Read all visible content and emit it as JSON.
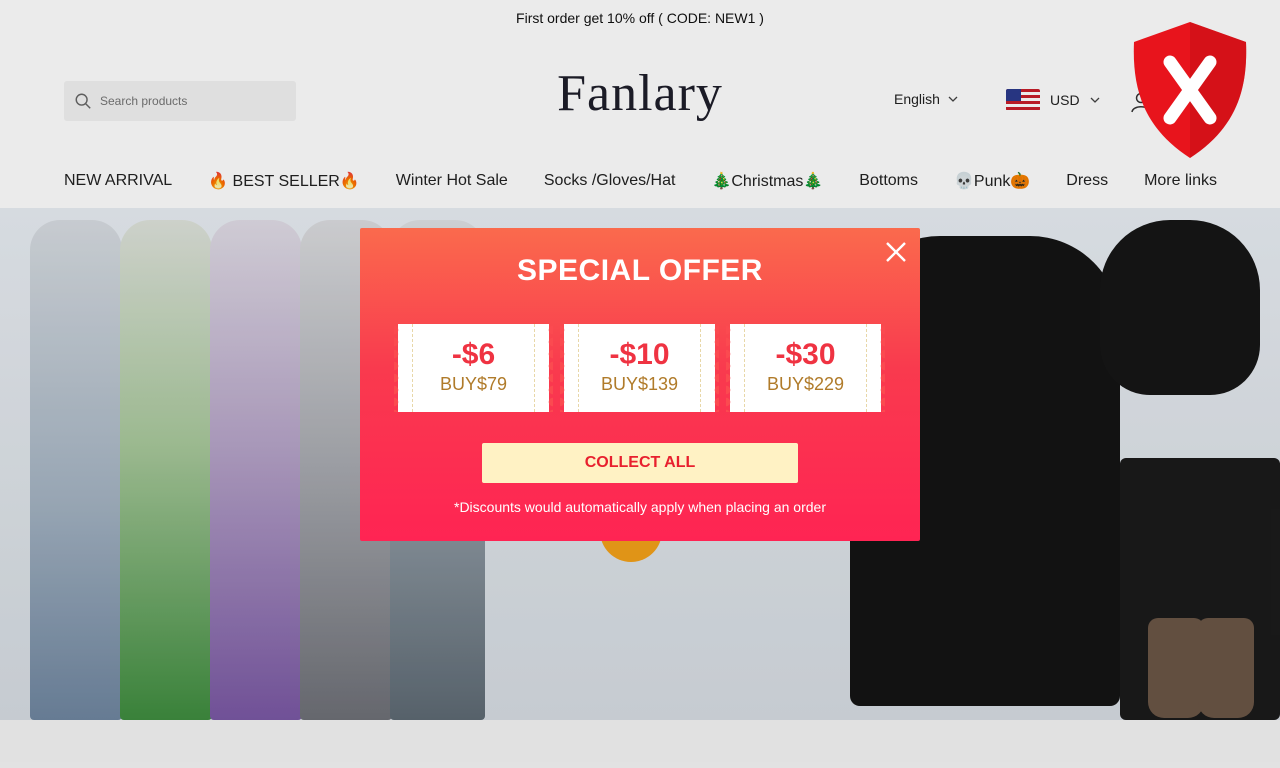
{
  "announcement": "First order get 10% off ( CODE: NEW1 )",
  "header": {
    "search_placeholder": "Search products",
    "logo": "Fanlary",
    "language": "English",
    "currency": "USD"
  },
  "nav": {
    "items": [
      "NEW ARRIVAL",
      "🔥 BEST SELLER🔥",
      "Winter Hot Sale",
      "Socks /Gloves/Hat",
      "🎄Christmas🎄",
      "Bottoms",
      "💀Punk🎃",
      "Dress",
      "More links"
    ]
  },
  "popup": {
    "title": "SPECIAL OFFER",
    "coupons": [
      {
        "amount": "-$6",
        "condition": "BUY$79"
      },
      {
        "amount": "-$10",
        "condition": "BUY$139"
      },
      {
        "amount": "-$30",
        "condition": "BUY$229"
      }
    ],
    "collect_label": "COLLECT ALL",
    "note": "*Discounts would automatically apply when placing an order"
  },
  "colors": {
    "popup_top": "#fa6a4d",
    "popup_bottom": "#ff2453",
    "coupon_amount": "#ef3342",
    "coupon_condition": "#b07b2a",
    "collect_bg": "#fff2c4",
    "shield": "#e8141c"
  },
  "icons": {
    "search": "search-icon",
    "chevron": "chevron-down-icon",
    "account": "account-icon",
    "close": "close-icon",
    "shield": "shield-x-icon"
  }
}
